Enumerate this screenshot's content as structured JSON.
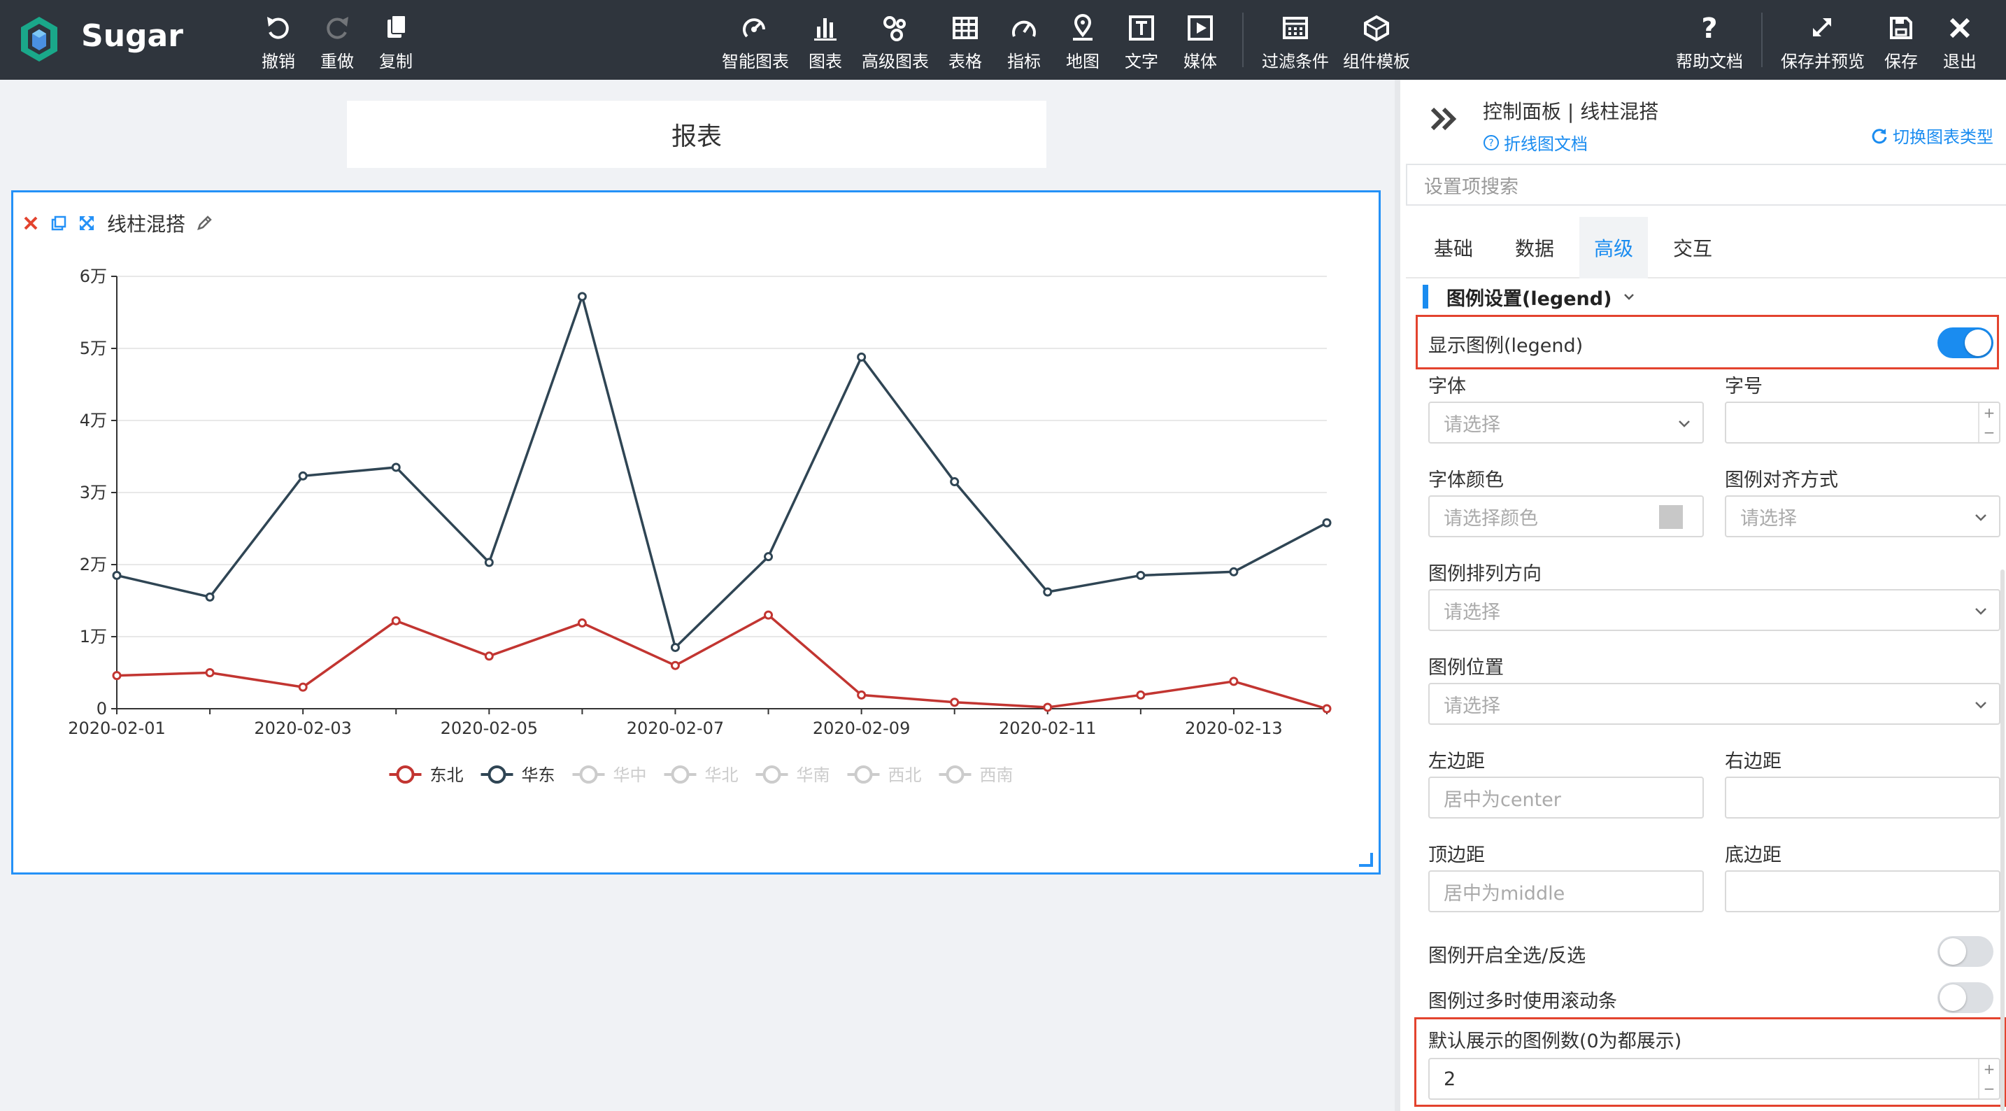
{
  "app": {
    "name": "Sugar"
  },
  "toolbar": {
    "left": [
      {
        "id": "undo",
        "label": "撤销",
        "icon": "undo-icon"
      },
      {
        "id": "redo",
        "label": "重做",
        "icon": "redo-icon"
      },
      {
        "id": "copy",
        "label": "复制",
        "icon": "copy-icon"
      }
    ],
    "center": [
      {
        "id": "smart",
        "label": "智能图表",
        "icon": "smart-chart-icon"
      },
      {
        "id": "chart",
        "label": "图表",
        "icon": "bar-chart-icon"
      },
      {
        "id": "adv",
        "label": "高级图表",
        "icon": "advanced-chart-icon"
      },
      {
        "id": "table",
        "label": "表格",
        "icon": "table-icon"
      },
      {
        "id": "metric",
        "label": "指标",
        "icon": "gauge-icon"
      },
      {
        "id": "map",
        "label": "地图",
        "icon": "map-pin-icon"
      },
      {
        "id": "text",
        "label": "文字",
        "icon": "text-icon"
      },
      {
        "id": "media",
        "label": "媒体",
        "icon": "play-icon"
      },
      {
        "id": "filter",
        "label": "过滤条件",
        "icon": "filter-icon"
      },
      {
        "id": "template",
        "label": "组件模板",
        "icon": "template-icon"
      }
    ],
    "right": [
      {
        "id": "help",
        "label": "帮助文档",
        "icon": "help-icon"
      },
      {
        "id": "savepreview",
        "label": "保存并预览",
        "icon": "expand-icon"
      },
      {
        "id": "save",
        "label": "保存",
        "icon": "save-icon"
      },
      {
        "id": "exit",
        "label": "退出",
        "icon": "close-icon"
      }
    ]
  },
  "report": {
    "title": "报表"
  },
  "widget": {
    "title": "线柱混搭"
  },
  "chart_data": {
    "type": "line",
    "x": [
      "2020-02-01",
      "2020-02-02",
      "2020-02-03",
      "2020-02-04",
      "2020-02-05",
      "2020-02-06",
      "2020-02-07",
      "2020-02-08",
      "2020-02-09",
      "2020-02-10",
      "2020-02-11",
      "2020-02-12",
      "2020-02-13",
      "2020-02-14"
    ],
    "x_tick_labels": [
      "2020-02-01",
      "2020-02-03",
      "2020-02-05",
      "2020-02-07",
      "2020-02-09",
      "2020-02-11",
      "2020-02-13"
    ],
    "y_tick_labels": [
      "0",
      "1万",
      "2万",
      "3万",
      "4万",
      "5万",
      "6万"
    ],
    "ylim": [
      0,
      60000
    ],
    "grid": true,
    "legend_position": "bottom-center",
    "series": [
      {
        "name": "东北",
        "color": "#c23531",
        "visible": true,
        "values": [
          4600,
          5000,
          3000,
          12200,
          7300,
          11900,
          6000,
          13000,
          1900,
          900,
          200,
          1900,
          3800,
          0
        ]
      },
      {
        "name": "华东",
        "color": "#2f4554",
        "visible": true,
        "values": [
          18500,
          15500,
          32300,
          33500,
          20300,
          57200,
          8500,
          21100,
          48800,
          31500,
          16200,
          18500,
          19000,
          25800
        ]
      },
      {
        "name": "华中",
        "color": "#cccccc",
        "visible": false,
        "values": []
      },
      {
        "name": "华北",
        "color": "#cccccc",
        "visible": false,
        "values": []
      },
      {
        "name": "华南",
        "color": "#cccccc",
        "visible": false,
        "values": []
      },
      {
        "name": "西北",
        "color": "#cccccc",
        "visible": false,
        "values": []
      },
      {
        "name": "西南",
        "color": "#cccccc",
        "visible": false,
        "values": []
      }
    ]
  },
  "panel": {
    "title": "控制面板 | 线柱混搭",
    "doc_link": "折线图文档",
    "switch_type": "切换图表类型",
    "search_placeholder": "设置项搜索",
    "tabs": [
      "基础",
      "数据",
      "高级",
      "交互"
    ],
    "active_tab": "高级",
    "section": "图例设置(legend)",
    "show_legend_label": "显示图例(legend)",
    "show_legend_on": true,
    "font_label": "字体",
    "font_placeholder": "请选择",
    "size_label": "字号",
    "color_label": "字体颜色",
    "color_placeholder": "请选择颜色",
    "align_label": "图例对齐方式",
    "align_placeholder": "请选择",
    "orient_label": "图例排列方向",
    "orient_placeholder": "请选择",
    "position_label": "图例位置",
    "position_placeholder": "请选择",
    "left_label": "左边距",
    "left_placeholder": "居中为center",
    "right_label": "右边距",
    "top_label": "顶边距",
    "top_placeholder": "居中为middle",
    "bottom_label": "底边距",
    "select_all_label": "图例开启全选/反选",
    "scroll_label": "图例过多时使用滚动条",
    "default_count_label": "默认展示的图例数(0为都展示)",
    "default_count_value": "2",
    "stepper_plus": "+",
    "stepper_minus": "−"
  }
}
